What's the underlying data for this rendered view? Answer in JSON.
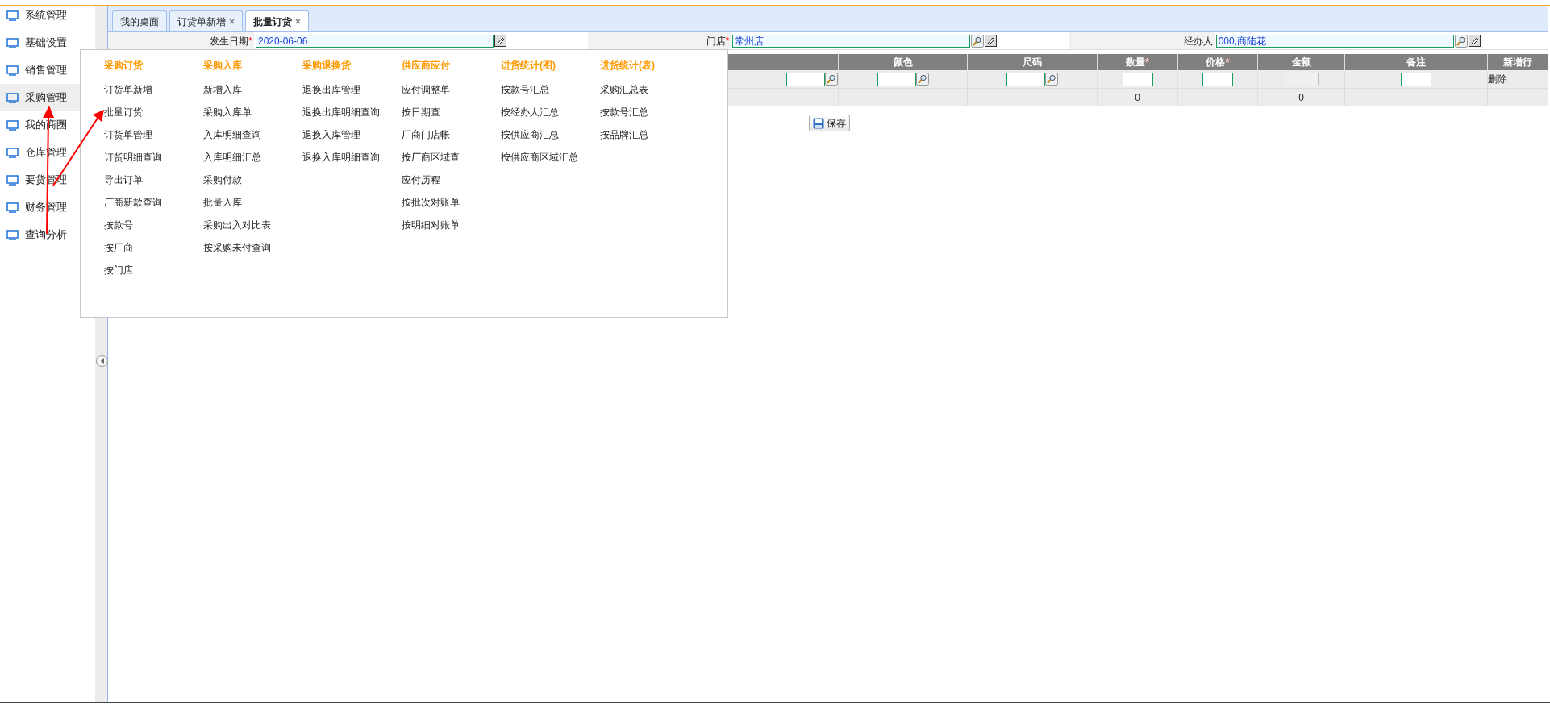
{
  "sidebar": {
    "items": [
      {
        "label": "系统管理",
        "selected": false
      },
      {
        "label": "基础设置",
        "selected": false
      },
      {
        "label": "销售管理",
        "selected": false
      },
      {
        "label": "采购管理",
        "selected": true
      },
      {
        "label": "我的商圈",
        "selected": false
      },
      {
        "label": "仓库管理",
        "selected": false
      },
      {
        "label": "要货管理",
        "selected": false
      },
      {
        "label": "财务管理",
        "selected": false
      },
      {
        "label": "查询分析",
        "selected": false
      }
    ]
  },
  "tabs": [
    {
      "label": "我的桌面",
      "selected": false,
      "closable": false
    },
    {
      "label": "订货单新增",
      "selected": false,
      "closable": true
    },
    {
      "label": "批量订货",
      "selected": true,
      "closable": true
    }
  ],
  "form": {
    "fields": [
      {
        "label": "发生日期",
        "required_mark": "*",
        "value": "2020-06-06",
        "kind": "date"
      },
      {
        "label": "门店",
        "required_mark": "*",
        "value": "常州店",
        "kind": "lookup"
      },
      {
        "label": "经办人",
        "value": "000,商陆花",
        "kind": "lookup"
      }
    ]
  },
  "table": {
    "columns": [
      {
        "cell": {
          "kind": "lookup"
        }
      },
      {
        "label": "颜色",
        "cell": {
          "kind": "lookup"
        }
      },
      {
        "label": "尺码",
        "cell": {
          "kind": "lookup"
        }
      },
      {
        "label": "数量",
        "required_mark": "*",
        "cell": {
          "kind": "input"
        },
        "total": "0"
      },
      {
        "label": "价格",
        "required_mark": "*",
        "cell": {
          "kind": "input"
        }
      },
      {
        "label": "金额",
        "cell": {
          "kind": "readonly"
        },
        "total": "0"
      },
      {
        "label": "备注",
        "cell": {
          "kind": "input"
        }
      },
      {
        "label": "新增行",
        "cell": {
          "kind": "text",
          "text": "删除"
        }
      }
    ]
  },
  "save_button": "保存",
  "menu": {
    "columns": [
      {
        "heading": "采购订货",
        "items": [
          "订货单新增",
          "批量订货",
          "订货单管理",
          "订货明细查询",
          "导出订单",
          "厂商新款查询",
          "按款号",
          "按厂商",
          "按门店"
        ]
      },
      {
        "heading": "采购入库",
        "items": [
          "新增入库",
          "采购入库单",
          "入库明细查询",
          "入库明细汇总",
          "采购付款",
          "批量入库",
          "采购出入对比表",
          "按采购未付查询"
        ]
      },
      {
        "heading": "采购退换货",
        "items": [
          "退换出库管理",
          "退换出库明细查询",
          "退换入库管理",
          "退换入库明细查询"
        ]
      },
      {
        "heading": "供应商应付",
        "items": [
          "应付调整单",
          "按日期查",
          "厂商门店帐",
          "按厂商区域查",
          "应付历程",
          "按批次对账单",
          "按明细对账单"
        ]
      },
      {
        "heading": "进货统计(图)",
        "items": [
          "按款号汇总",
          "按经办人汇总",
          "按供应商汇总",
          "按供应商区域汇总"
        ]
      },
      {
        "heading": "进货统计(表)",
        "items": [
          "采购汇总表",
          "按款号汇总",
          "按品牌汇总"
        ]
      }
    ]
  }
}
